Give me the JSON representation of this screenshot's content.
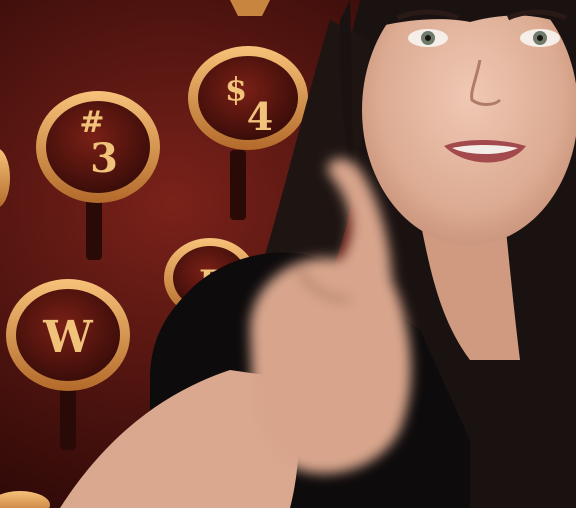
{
  "keys": {
    "k3": {
      "top": "#",
      "bottom": "3"
    },
    "k4": {
      "top": "$",
      "bottom": "4"
    },
    "kw": {
      "label": "W"
    },
    "ke": {
      "label": "E"
    }
  },
  "colors": {
    "background": "#3a0d0a",
    "key_ring": "#e7a24c",
    "key_face": "#5a1712",
    "key_glyph": "#f1c27a",
    "shirt": "#0e0b0c",
    "skin": "#e2b39a",
    "hair": "#1a1211"
  }
}
